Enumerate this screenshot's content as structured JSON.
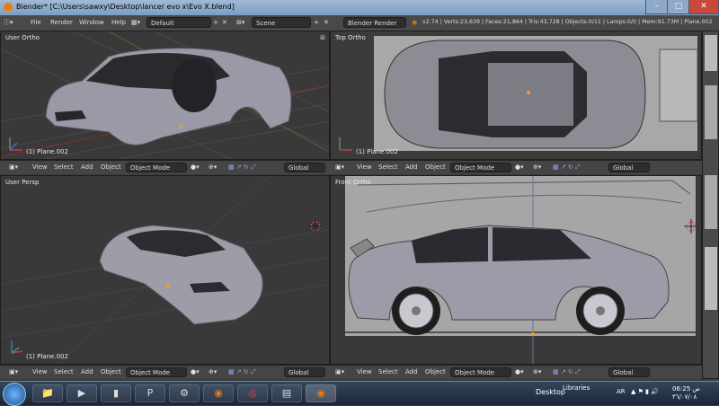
{
  "window": {
    "title": "Blender* [C:\\Users\\sawxy\\Desktop\\lancer evo x\\Evo X.blend]"
  },
  "menu": {
    "file": "File",
    "render": "Render",
    "window": "Window",
    "help": "Help"
  },
  "layout": {
    "screen": "Default",
    "scene": "Scene",
    "engine": "Blender Render"
  },
  "stats": "v2.74 | Verts:23,639 | Faces:21,864 | Tris:43,728 | Objects:0/11 | Lamps:0/0 | Mem:91.73M | Plane.002",
  "viewports": {
    "tl": {
      "label": "User Ortho",
      "obj": "(1) Plane.002"
    },
    "tr": {
      "label": "Top Ortho",
      "obj": "(1) Plane.002"
    },
    "bl": {
      "label": "User Persp",
      "obj": "(1) Plane.002"
    },
    "br": {
      "label": "Front Ortho",
      "obj": "(1) Plane.002"
    }
  },
  "header": {
    "view": "View",
    "select": "Select",
    "add": "Add",
    "object": "Object",
    "mode": "Object Mode",
    "orientation": "Global"
  },
  "taskbar": {
    "desktop": "Desktop",
    "libraries": "Libraries",
    "lang": "AR",
    "time": "06:25 ص",
    "date": "٣٦/٠٧/٠٨"
  }
}
